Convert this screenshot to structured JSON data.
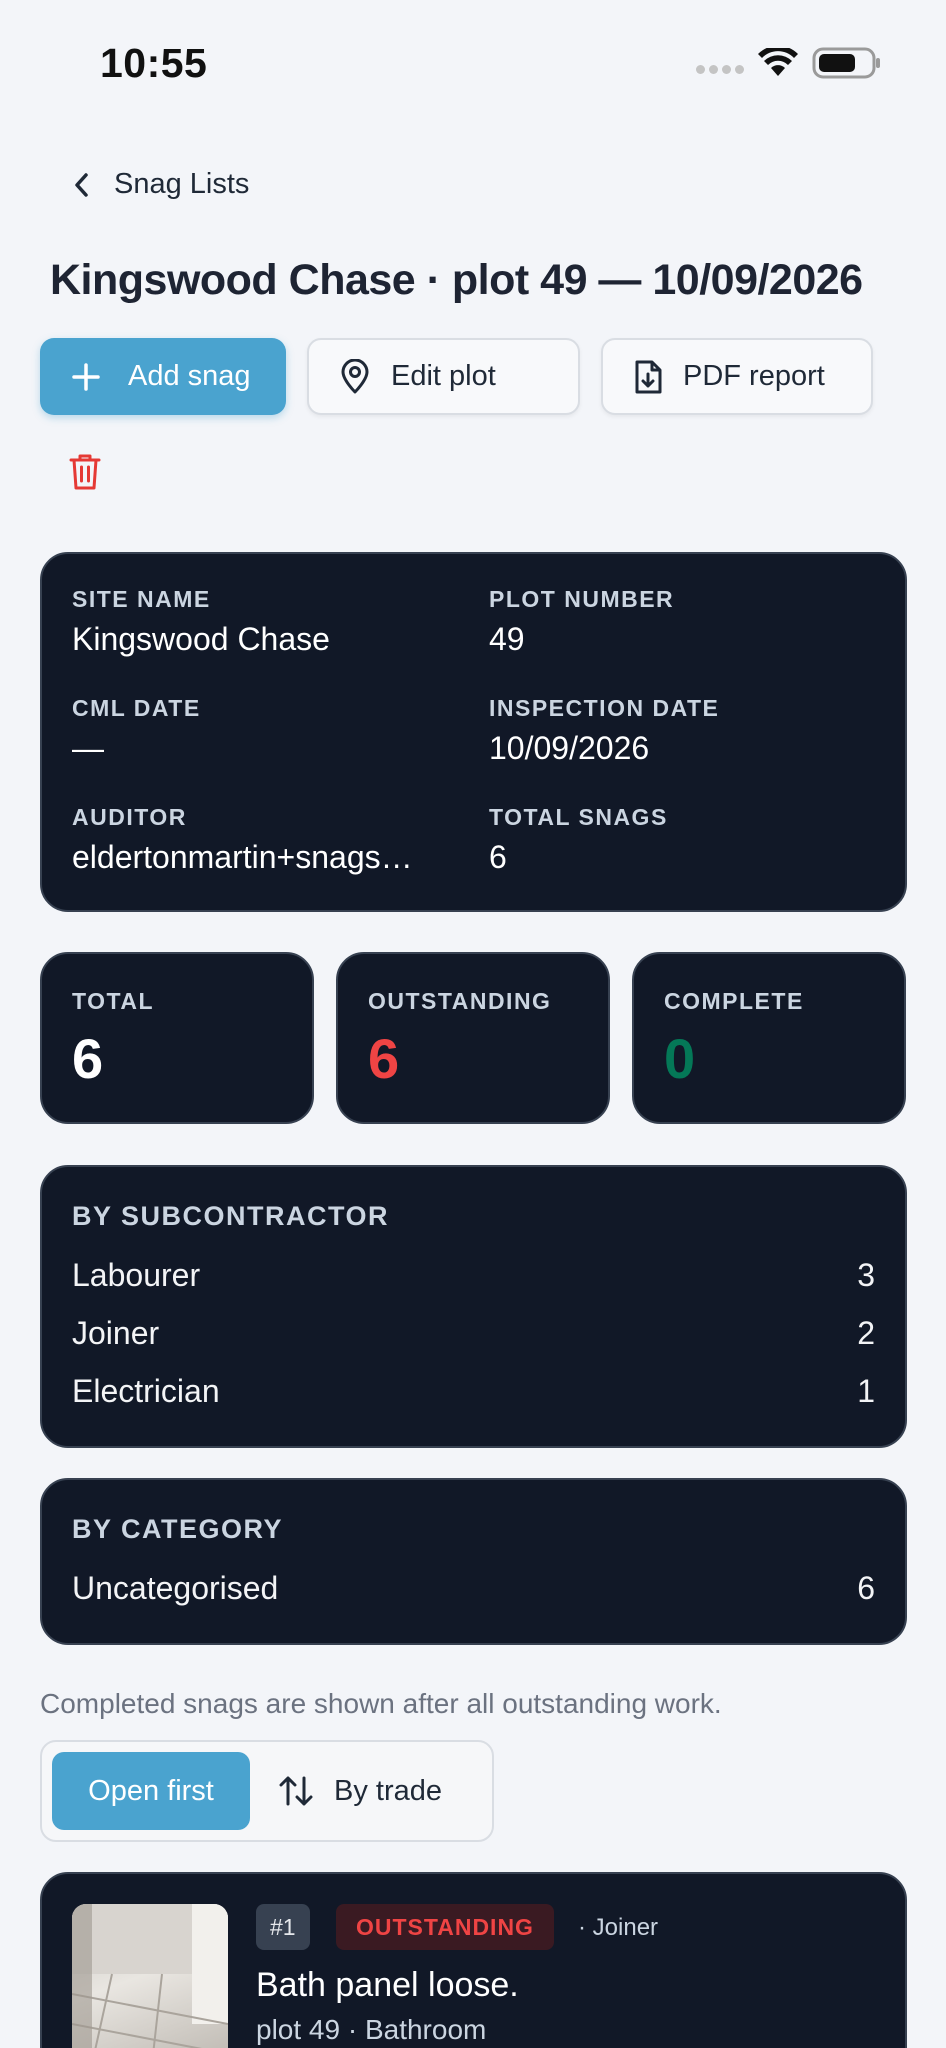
{
  "status_bar": {
    "time": "10:55"
  },
  "nav": {
    "back_label": "Snag Lists"
  },
  "page_title": "Kingswood Chase · plot 49 — 10/09/2026",
  "actions": {
    "add_snag": "Add snag",
    "edit_plot": "Edit plot",
    "pdf_report": "PDF report"
  },
  "info": {
    "site_name_label": "SITE NAME",
    "site_name": "Kingswood Chase",
    "plot_number_label": "PLOT NUMBER",
    "plot_number": "49",
    "cml_date_label": "CML DATE",
    "cml_date": "—",
    "inspection_date_label": "INSPECTION DATE",
    "inspection_date": "10/09/2026",
    "auditor_label": "AUDITOR",
    "auditor": "eldertonmartin+snags…",
    "total_snags_label": "TOTAL SNAGS",
    "total_snags": "6"
  },
  "stats": {
    "total_label": "TOTAL",
    "total": "6",
    "outstanding_label": "OUTSTANDING",
    "outstanding": "6",
    "complete_label": "COMPLETE",
    "complete": "0"
  },
  "by_subcontractor": {
    "title": "BY SUBCONTRACTOR",
    "rows": [
      {
        "name": "Labourer",
        "count": "3"
      },
      {
        "name": "Joiner",
        "count": "2"
      },
      {
        "name": "Electrician",
        "count": "1"
      }
    ]
  },
  "by_category": {
    "title": "BY CATEGORY",
    "rows": [
      {
        "name": "Uncategorised",
        "count": "6"
      }
    ]
  },
  "note": "Completed snags are shown after all outstanding work.",
  "sort": {
    "open_first": "Open first",
    "by_trade": "By trade"
  },
  "snags": [
    {
      "number": "#1",
      "status": "OUTSTANDING",
      "trade": "· Joiner",
      "title": "Bath panel loose.",
      "subtitle": "plot 49 · Bathroom"
    }
  ],
  "colors": {
    "accent": "#4aa3cf",
    "outstanding": "#ef4444",
    "complete": "#047857",
    "card_bg": "#111827"
  }
}
